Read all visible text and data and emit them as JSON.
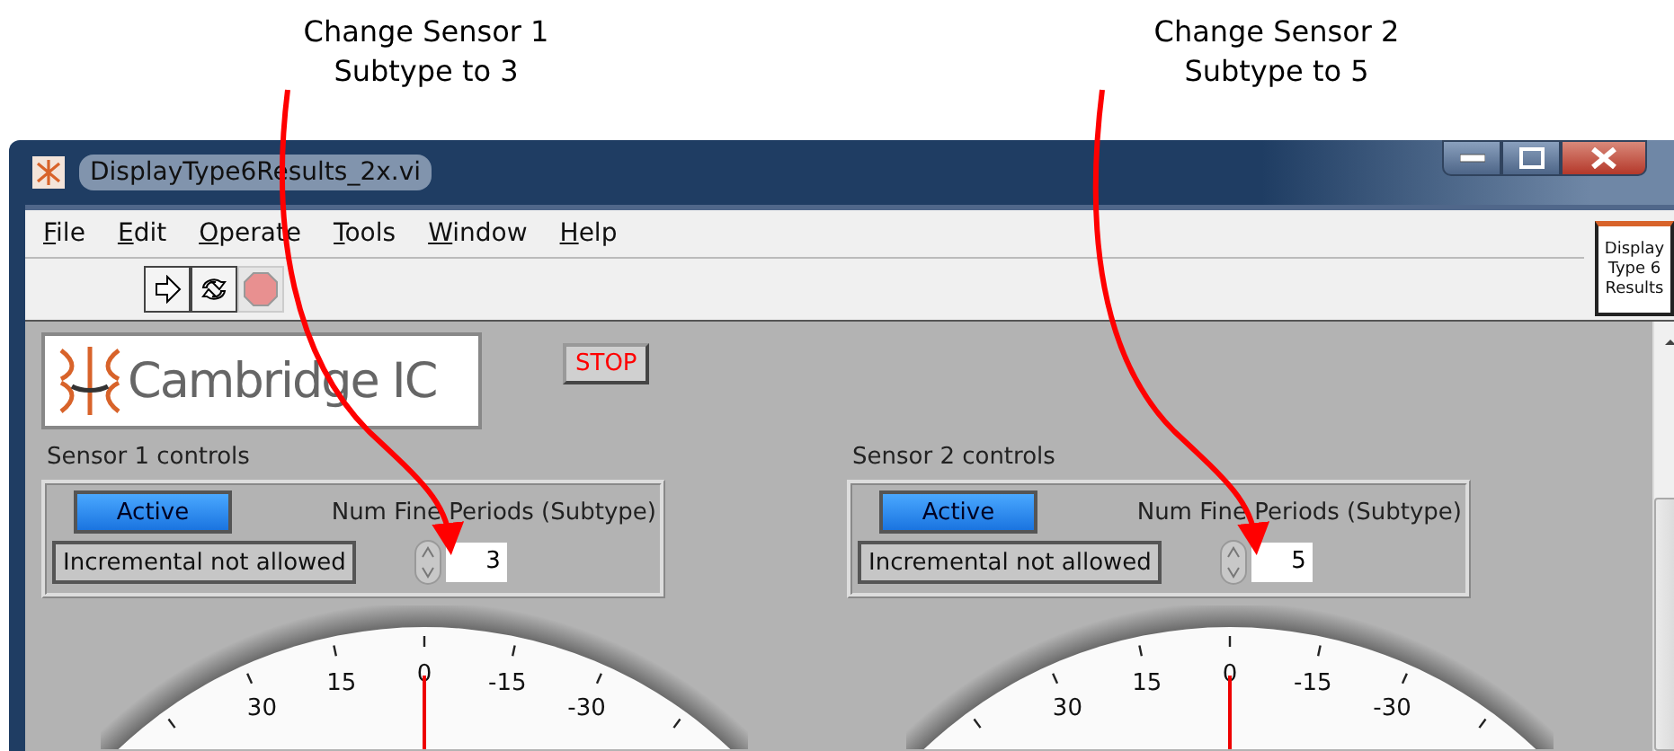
{
  "annotations": [
    {
      "lines": [
        "Change Sensor 1",
        "Subtype  to 3"
      ]
    },
    {
      "lines": [
        "Change Sensor 2",
        "Subtype  to 5"
      ]
    }
  ],
  "window": {
    "title": "DisplayType6Results_2x.vi"
  },
  "menu": [
    {
      "label": "File"
    },
    {
      "label": "Edit"
    },
    {
      "label": "Operate"
    },
    {
      "label": "Tools"
    },
    {
      "label": "Window"
    },
    {
      "label": "Help"
    }
  ],
  "toolbar": [
    {
      "kind": "run",
      "disabled": false
    },
    {
      "kind": "run-continuous",
      "disabled": false
    },
    {
      "kind": "abort",
      "disabled": true
    }
  ],
  "vi_icon": {
    "lines": [
      "Display",
      "Type 6",
      "Results"
    ]
  },
  "logo": {
    "text": "Cambridge IC"
  },
  "stop_button": {
    "label": "STOP"
  },
  "sensors": [
    {
      "title": "Sensor 1 controls",
      "active": {
        "label": "Active",
        "on": true
      },
      "incremental": {
        "label": "Incremental not allowed",
        "on": false
      },
      "periods_label": "Num Fine Periods (Subtype)",
      "periods_value": "3",
      "dial_ticks": [
        "30",
        "15",
        "0",
        "-15",
        "-30"
      ]
    },
    {
      "title": "Sensor 2 controls",
      "active": {
        "label": "Active",
        "on": true
      },
      "incremental": {
        "label": "Incremental not allowed",
        "on": false
      },
      "periods_label": "Num Fine Periods (Subtype)",
      "periods_value": "5",
      "dial_ticks": [
        "30",
        "15",
        "0",
        "-15",
        "-30"
      ]
    }
  ]
}
